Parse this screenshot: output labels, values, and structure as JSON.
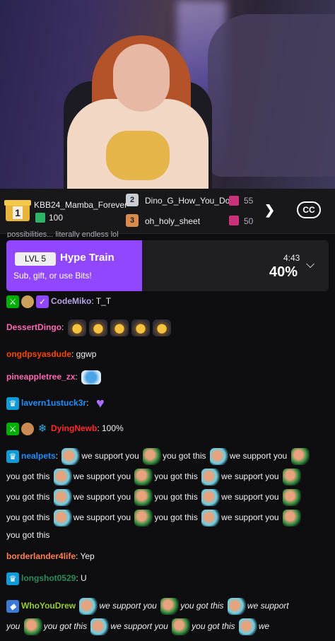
{
  "gift_leaderboard": {
    "first": {
      "rank": "1",
      "user": "KBB24_Mamba_Forever",
      "count": "100"
    },
    "second": {
      "rank": "2",
      "user": "Dino_G_How_You_Doin",
      "count": "55"
    },
    "third": {
      "rank": "3",
      "user": "oh_holy_sheet",
      "count": "50"
    },
    "next_icon": "chevron-right-icon",
    "cc_label": "CC"
  },
  "partial_message": "possibilities... literally endless lol",
  "hype_train": {
    "level": "LVL 5",
    "title": "Hype Train",
    "subtitle": "Sub, gift, or use Bits!",
    "time_left": "4:43",
    "progress": "40%",
    "progress_fraction": 0.4
  },
  "chat": {
    "m1": {
      "user": "CodeMiko",
      "text": ": T_T",
      "color": "#b9a3e3"
    },
    "m2": {
      "user": "DessertDingo",
      "color": "#ff69b4"
    },
    "m3": {
      "user": "ongdpsyasdude",
      "text": ": ggwp",
      "color": "#ff4500"
    },
    "m4": {
      "user": "pineappletree_zx",
      "color": "#ff69b4"
    },
    "m5": {
      "user": "lavern1ustuck3r",
      "color": "#1e90ff"
    },
    "m6": {
      "user": "DyingNewb",
      "text": ": 100%",
      "color": "#ff2b2b"
    },
    "m7": {
      "user": "nealpets",
      "color": "#1e90ff",
      "p1": "we support you",
      "p2": "you got this",
      "p3": "we support you",
      "p4": "you got this",
      "p5": "we support you",
      "p6": "you got this",
      "p7": "we support you",
      "p8": "you got this",
      "p9": "we support you",
      "p10": "you got this",
      "p11": "we support you",
      "p12": "you got this",
      "p13": "we support you",
      "p14": "you got this",
      "p15": "we support you",
      "p16": "you got this"
    },
    "m8": {
      "user": "borderlander4life",
      "text": ": Yep",
      "color": "#ff7f50"
    },
    "m9": {
      "user": "longshot0529",
      "text": ": U",
      "color": "#2e8b57"
    },
    "m10": {
      "user": "WhoYouDrew",
      "color": "#9acd32",
      "p1": "we support you",
      "p2": "you got this",
      "p3": "we support",
      "p4": "you",
      "p5": "you got this",
      "p6": "we support you",
      "p7": "you got this",
      "p8": "we"
    }
  },
  "colors": {
    "accent": "#9147ff",
    "background": "#0e0e10",
    "panel": "#18181b"
  }
}
